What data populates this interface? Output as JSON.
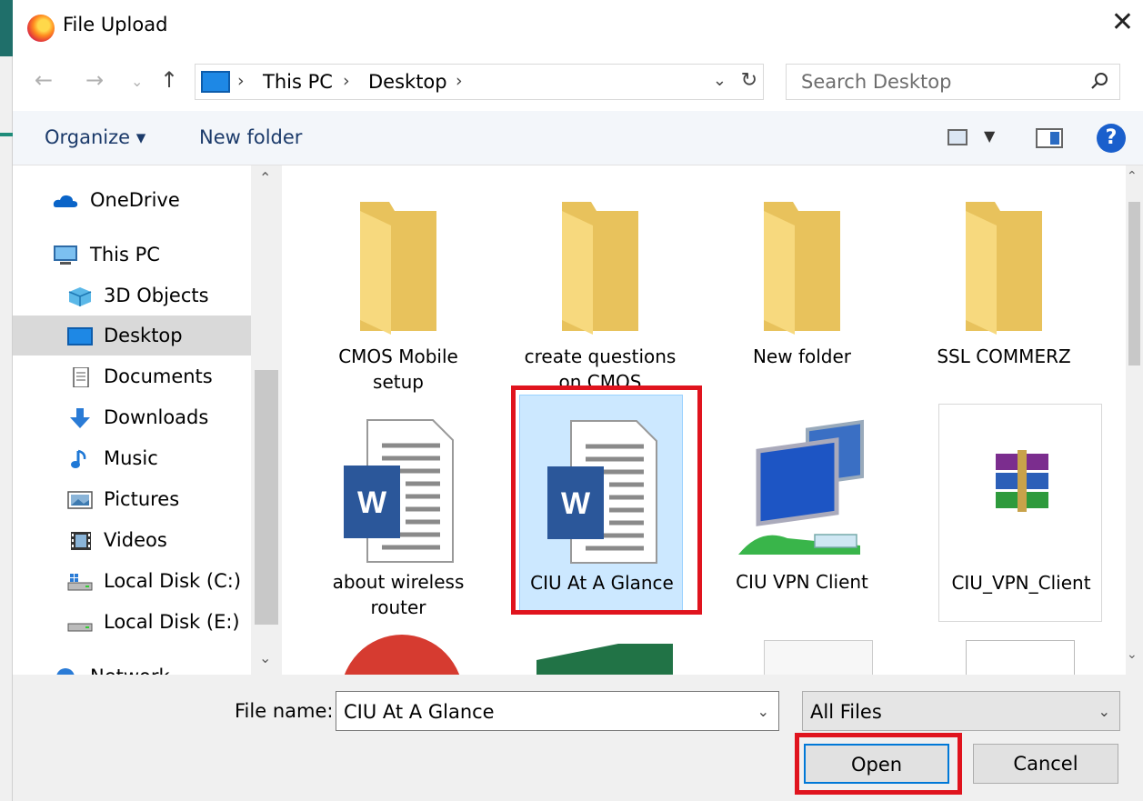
{
  "window": {
    "title": "File Upload"
  },
  "address": {
    "crumbs": [
      "This PC",
      "Desktop"
    ],
    "search_placeholder": "Search Desktop"
  },
  "toolbar": {
    "organize_label": "Organize ▾",
    "new_folder_label": "New folder"
  },
  "nav_items": [
    {
      "label": "OneDrive",
      "icon": "onedrive-icon"
    },
    {
      "label": "This PC",
      "icon": "this-pc-icon"
    },
    {
      "label": "3D Objects",
      "icon": "3d-objects-icon"
    },
    {
      "label": "Desktop",
      "icon": "desktop-icon",
      "selected": true
    },
    {
      "label": "Documents",
      "icon": "documents-icon"
    },
    {
      "label": "Downloads",
      "icon": "downloads-icon"
    },
    {
      "label": "Music",
      "icon": "music-icon"
    },
    {
      "label": "Pictures",
      "icon": "pictures-icon"
    },
    {
      "label": "Videos",
      "icon": "videos-icon"
    },
    {
      "label": "Local Disk (C:)",
      "icon": "drive-c-icon"
    },
    {
      "label": "Local Disk (E:)",
      "icon": "drive-e-icon"
    },
    {
      "label": "Network",
      "icon": "network-icon"
    }
  ],
  "files": [
    {
      "name": "CMOS Mobile setup",
      "line1": "CMOS Mobile",
      "line2": "setup",
      "type": "folder"
    },
    {
      "name": "create questions on CMOS",
      "line1": "create questions",
      "line2": "on CMOS",
      "type": "folder"
    },
    {
      "name": "New folder",
      "line1": "New folder",
      "line2": "",
      "type": "folder"
    },
    {
      "name": "SSL COMMERZ",
      "line1": "SSL COMMERZ",
      "line2": "",
      "type": "folder"
    },
    {
      "name": "about wireless router",
      "line1": "about wireless",
      "line2": "router",
      "type": "word-doc"
    },
    {
      "name": "CIU At A Glance",
      "line1": "CIU At A Glance",
      "line2": "",
      "type": "word-doc",
      "selected": true
    },
    {
      "name": "CIU VPN Client",
      "line1": "CIU VPN Client",
      "line2": "",
      "type": "network-shortcut"
    },
    {
      "name": "CIU_VPN_Client",
      "line1": "CIU_VPN_Client",
      "line2": "",
      "type": "winrar-archive"
    }
  ],
  "bottom": {
    "file_name_label": "File name:",
    "file_name_value": "CIU At A Glance",
    "file_type_value": "All Files",
    "open_label": "Open",
    "cancel_label": "Cancel"
  },
  "colors": {
    "highlight": "#e0141e",
    "selection": "#cce8ff",
    "accent": "#0078d7"
  }
}
